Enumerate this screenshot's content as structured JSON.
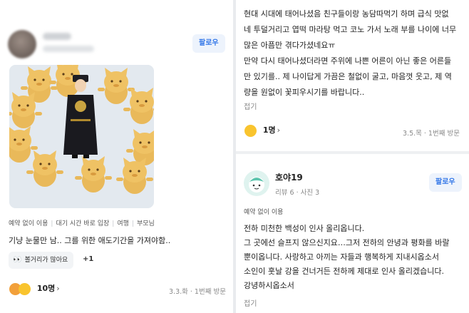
{
  "left_review": {
    "follow_label": "팔로우",
    "tags": [
      "예약 없이 이용",
      "대기 시간 바로 입장",
      "여행",
      "부모님"
    ],
    "text": "기냥 눈물만 남.. 그를 위한 애도기간을 가져야함..",
    "keyword_chip": "볼거리가 많아요",
    "more_keywords": "+1",
    "reactions_count": "10명",
    "visit_info": "3.3.화 · 1번째 방문"
  },
  "right_top_review": {
    "text_lines": [
      "현대 시대에 태어나셨음 친구들이랑 농담따먹기 하며 급식 맛없",
      "네 투덜거리고 엽떡 마라탕 먹고 코노 가서 노래 부를 나이에 너무",
      "많은 아픔만 겪다가셨네요ㅠ",
      "만약 다시 태어나셨더라면 주위에 나쁜 어른이 아닌 좋은 어른들",
      "만 있기를.. 제 나이답게 가끔은 철없이 굴고, 마음껏 웃고, 제 역",
      "량을 원없이 꽃피우시기를 바랍니다.."
    ],
    "fold_label": "접기",
    "reactions_count": "1명",
    "visit_info": "3.5.목 · 1번째 방문"
  },
  "right_bottom_review": {
    "reviewer_name": "호야19",
    "reviewer_meta": "리뷰 6 · 사진 3",
    "follow_label": "팔로우",
    "tag": "예약 없이 이용",
    "text_lines": [
      "전하 미천한 백성이 인사 올리옵니다.",
      "그 곳에선 슬프지 않으신지요…그저 전하의 안녕과 평화를 바랄",
      "뿐이옵니다. 사랑하고 아끼는 자들과 행복하게 지내시옵소서",
      "소인이 훗날 강을 건너거든 전하께 제대로 인사 올리겠습니다.",
      "강녕하시옵소서"
    ],
    "fold_label": "접기"
  },
  "colors": {
    "accent_blue": "#3478e8",
    "follow_bg": "#edf3fc",
    "muted_text": "#888888",
    "divider": "#e9ebee"
  }
}
